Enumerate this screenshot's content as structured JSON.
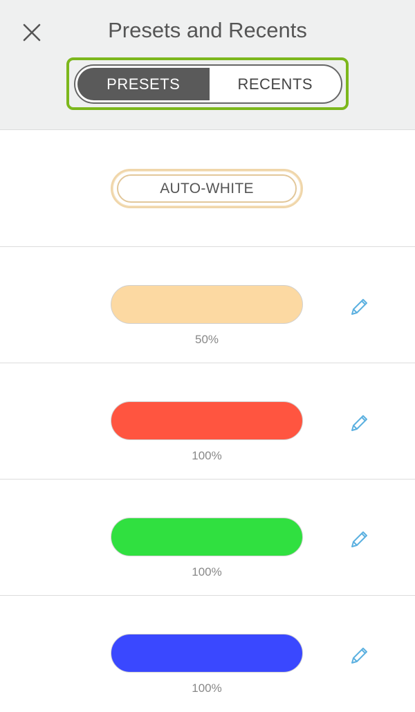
{
  "header": {
    "title": "Presets and Recents",
    "close_icon": "close-icon",
    "tabs": [
      {
        "label": "PRESETS",
        "active": true
      },
      {
        "label": "RECENTS",
        "active": false
      }
    ],
    "highlight_color": "#7cb71c"
  },
  "presets": {
    "auto_white_label": "AUTO-WHITE",
    "items": [
      {
        "color": "#fcd9a2",
        "brightness": "50%",
        "edit_icon": "pencil-icon"
      },
      {
        "color": "#ff5540",
        "brightness": "100%",
        "edit_icon": "pencil-icon"
      },
      {
        "color": "#30e040",
        "brightness": "100%",
        "edit_icon": "pencil-icon"
      },
      {
        "color": "#3a48ff",
        "brightness": "100%",
        "edit_icon": "pencil-icon"
      }
    ]
  },
  "colors": {
    "accent_icon": "#5bb0e0",
    "active_tab_bg": "#5a5a5a"
  }
}
